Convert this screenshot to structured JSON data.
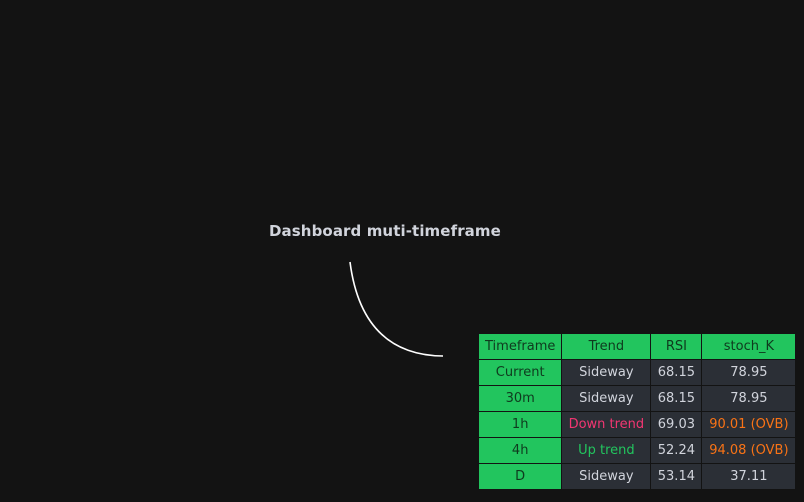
{
  "title": "Dashboard muti-timeframe",
  "colors": {
    "background": "#131313",
    "header_green": "#22c55e",
    "cell_gray": "#2b2f36",
    "text": "#d1d4dc",
    "down": "#f23672",
    "up": "#22c55e",
    "overbought": "#f97316"
  },
  "table": {
    "headers": [
      "Timeframe",
      "Trend",
      "RSI",
      "stoch_K"
    ],
    "rows": [
      {
        "timeframe": "Current",
        "trend": "Sideway",
        "trend_state": "neutral",
        "rsi": "68.15",
        "stoch": "78.95",
        "stoch_state": "neutral"
      },
      {
        "timeframe": "30m",
        "trend": "Sideway",
        "trend_state": "neutral",
        "rsi": "68.15",
        "stoch": "78.95",
        "stoch_state": "neutral"
      },
      {
        "timeframe": "1h",
        "trend": "Down trend",
        "trend_state": "down",
        "rsi": "69.03",
        "stoch": "90.01 (OVB)",
        "stoch_state": "overbought"
      },
      {
        "timeframe": "4h",
        "trend": "Up trend",
        "trend_state": "up",
        "rsi": "52.24",
        "stoch": "94.08 (OVB)",
        "stoch_state": "overbought"
      },
      {
        "timeframe": "D",
        "trend": "Sideway",
        "trend_state": "neutral",
        "rsi": "53.14",
        "stoch": "37.11",
        "stoch_state": "neutral"
      }
    ]
  }
}
